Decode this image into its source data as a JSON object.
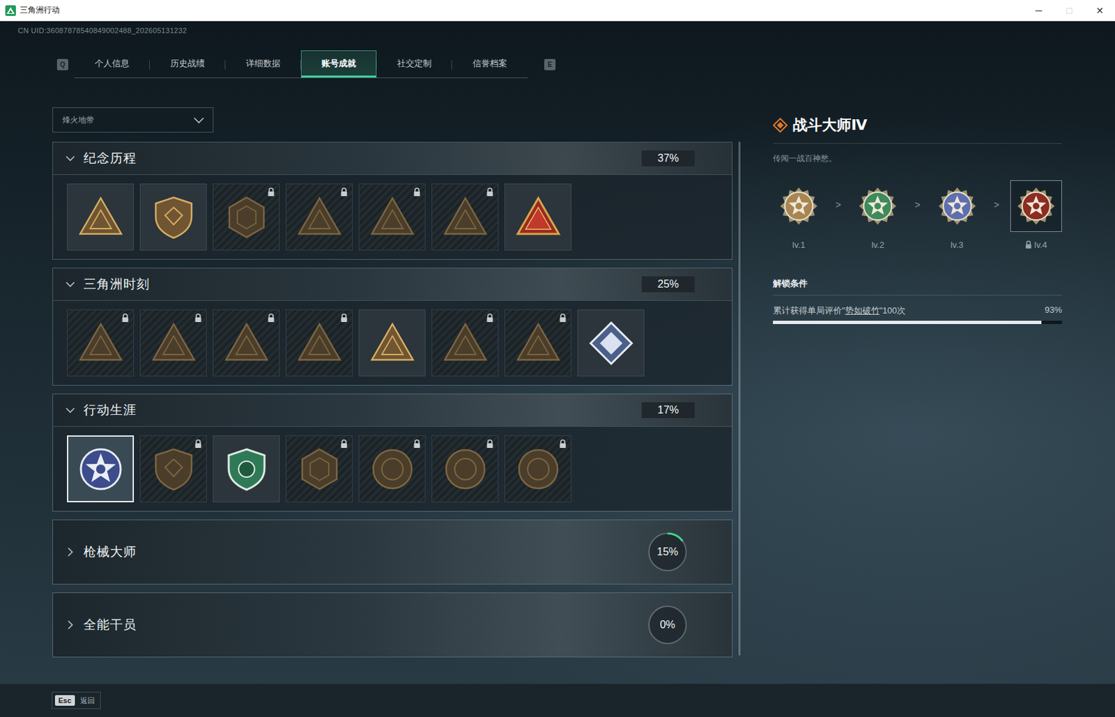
{
  "window": {
    "title": "三角洲行动",
    "controls": [
      {
        "glyph": "─",
        "disabled": false
      },
      {
        "glyph": "□",
        "disabled": true
      },
      {
        "glyph": "✕",
        "disabled": false
      }
    ]
  },
  "uid": "CN UID:36087878540849002488_202605131232",
  "tabs": {
    "prev_key": "Q",
    "next_key": "E",
    "items": [
      {
        "label": "个人信息",
        "selected": false
      },
      {
        "label": "历史战绩",
        "selected": false
      },
      {
        "label": "详细数据",
        "selected": false
      },
      {
        "label": "账号成就",
        "selected": true
      },
      {
        "label": "社交定制",
        "selected": false
      },
      {
        "label": "信誉档案",
        "selected": false
      }
    ]
  },
  "mode_select": {
    "value": "烽火地带"
  },
  "sections": [
    {
      "title": "纪念历程",
      "percent": "37%",
      "expanded": true,
      "badges": [
        {
          "locked": false,
          "selected": false
        },
        {
          "locked": false,
          "selected": false
        },
        {
          "locked": true,
          "selected": false
        },
        {
          "locked": true,
          "selected": false
        },
        {
          "locked": true,
          "selected": false
        },
        {
          "locked": true,
          "selected": false
        },
        {
          "locked": false,
          "selected": false
        }
      ]
    },
    {
      "title": "三角洲时刻",
      "percent": "25%",
      "expanded": true,
      "badges": [
        {
          "locked": true,
          "selected": false
        },
        {
          "locked": true,
          "selected": false
        },
        {
          "locked": true,
          "selected": false
        },
        {
          "locked": true,
          "selected": false
        },
        {
          "locked": false,
          "selected": false
        },
        {
          "locked": true,
          "selected": false
        },
        {
          "locked": true,
          "selected": false
        },
        {
          "locked": false,
          "selected": false
        }
      ]
    },
    {
      "title": "行动生涯",
      "percent": "17%",
      "expanded": true,
      "badges": [
        {
          "locked": false,
          "selected": true
        },
        {
          "locked": true,
          "selected": false
        },
        {
          "locked": false,
          "selected": false
        },
        {
          "locked": true,
          "selected": false
        },
        {
          "locked": true,
          "selected": false
        },
        {
          "locked": true,
          "selected": false
        },
        {
          "locked": true,
          "selected": false
        }
      ]
    },
    {
      "title": "枪械大师",
      "percent": "15%",
      "expanded": false,
      "level": 0.15
    },
    {
      "title": "全能干员",
      "percent": "0%",
      "expanded": false,
      "level": 0
    }
  ],
  "detail": {
    "title": "战斗大师Ⅳ",
    "description": "传闻一战百神愁。",
    "separator": ">",
    "levels": [
      {
        "label": "lv.1",
        "locked": false,
        "selected": false,
        "color": "#a88552"
      },
      {
        "label": "lv.2",
        "locked": false,
        "selected": false,
        "color": "#3f8a5c"
      },
      {
        "label": "lv.3",
        "locked": false,
        "selected": false,
        "color": "#5f6fae"
      },
      {
        "label": "lv.4",
        "locked": true,
        "selected": true,
        "color": "#8c2c22"
      }
    ],
    "unlock": {
      "heading": "解锁条件",
      "prefix": "累计获得单局评价\"",
      "highlight": "势如破竹",
      "suffix": "\"100次",
      "percent": "93%",
      "level": 0.93
    }
  },
  "footer": {
    "key": "Esc",
    "label": "返回"
  }
}
